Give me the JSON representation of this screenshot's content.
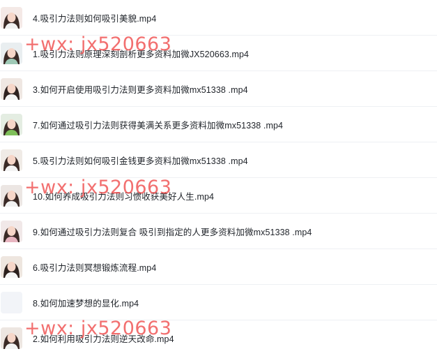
{
  "files": [
    {
      "name": "4.吸引力法则如何吸引美貌.mp4",
      "thumbnail": "person-video-thumbnail"
    },
    {
      "name": "1.吸引力法则原理深刻剖析更多资料加微JX520663.mp4",
      "thumbnail": "person-video-thumbnail"
    },
    {
      "name": "3.如何开启使用吸引力法则更多资料加微mx51338 .mp4",
      "thumbnail": "person-video-thumbnail"
    },
    {
      "name": "7.如何通过吸引力法则获得美满关系更多资料加微mx51338 .mp4",
      "thumbnail": "person-video-thumbnail"
    },
    {
      "name": "5.吸引力法则如何吸引金钱更多资料加微mx51338 .mp4",
      "thumbnail": "person-video-thumbnail"
    },
    {
      "name": "10.如何养成吸引力法则习惯收获美好人生.mp4",
      "thumbnail": "person-video-thumbnail"
    },
    {
      "name": "9.如何通过吸引力法则复合 吸引到指定的人更多资料加微mx51338 .mp4",
      "thumbnail": "person-video-thumbnail"
    },
    {
      "name": "6.吸引力法则冥想锻炼流程.mp4",
      "thumbnail": "person-video-thumbnail"
    },
    {
      "name": "8.如何加速梦想的显化.mp4",
      "thumbnail": "blank-thumbnail"
    },
    {
      "name": "2.如何利用吸引力法则逆天改命.mp4",
      "thumbnail": "person-video-thumbnail"
    }
  ],
  "watermarks": [
    "+wx: jx520663",
    "+wx: jx520663",
    "+wx: jx520663"
  ],
  "colors": {
    "watermark": "#ee4646",
    "text": "#1f2329",
    "divider": "#eef0f3"
  }
}
